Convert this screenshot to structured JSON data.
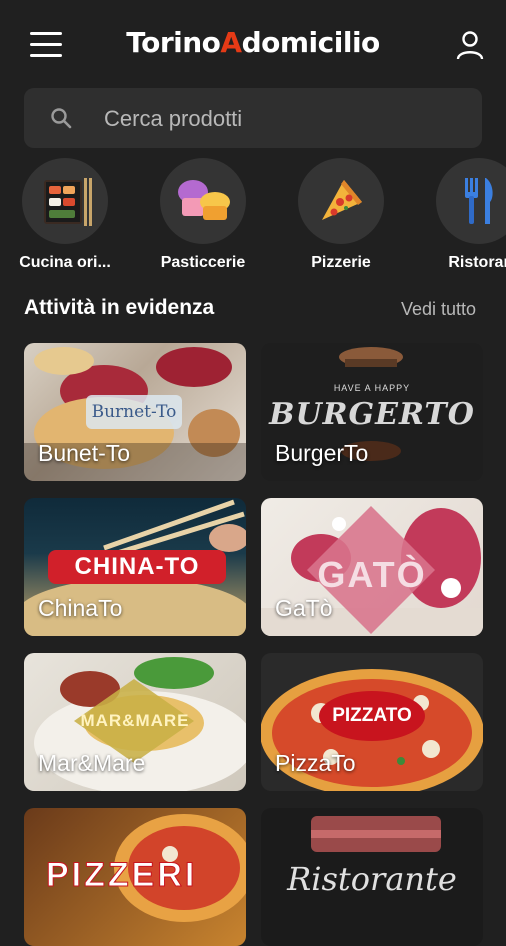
{
  "header": {
    "brand_left": "Torino",
    "brand_accent": "A",
    "brand_right": "domicilio"
  },
  "search": {
    "placeholder": "Cerca prodotti"
  },
  "categories": [
    {
      "label": "Cucina ori...",
      "icon": "sushi-icon"
    },
    {
      "label": "Pasticcerie",
      "icon": "cupcake-icon"
    },
    {
      "label": "Pizzerie",
      "icon": "pizza-slice-icon"
    },
    {
      "label": "Ristorar",
      "icon": "cutlery-icon"
    }
  ],
  "featured": {
    "title": "Attività in evidenza",
    "see_all": "Vedi tutto",
    "cards": [
      {
        "name": "Bunet-To",
        "logo": "Burnet-To"
      },
      {
        "name": "BurgerTo",
        "logo": "BURGERTO",
        "tagline": "HAVE A HAPPY"
      },
      {
        "name": "ChinaTo",
        "logo": "CHINA-TO"
      },
      {
        "name": "GaTò",
        "logo": "GATÒ"
      },
      {
        "name": "Mar&Mare",
        "logo": "MAR&MARE"
      },
      {
        "name": "PizzaTo",
        "logo": "PIZZATO"
      },
      {
        "name": "",
        "logo": "PIZZERI"
      },
      {
        "name": "",
        "logo": "Ristorante"
      }
    ]
  },
  "colors": {
    "background": "#202020",
    "accent": "#e53a16",
    "surface": "#2f2f2f"
  }
}
